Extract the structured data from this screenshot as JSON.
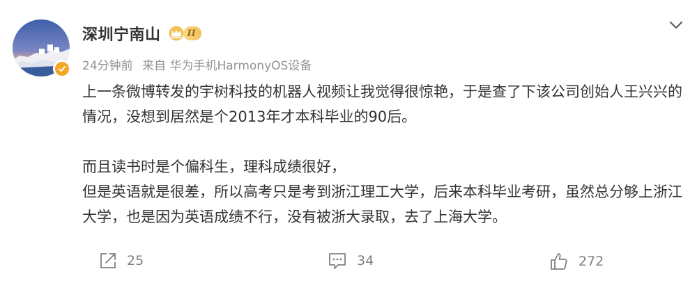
{
  "post": {
    "author": {
      "name": "深圳宁南山",
      "vip_rank": "II",
      "avatar_icon": "avatar-coastal-town",
      "verified_color": "#f5a623"
    },
    "meta": {
      "time": "24分钟前",
      "source": "来自 华为手机HarmonyOS设备"
    },
    "content": {
      "paragraph_1": "上一条微博转发的宇树科技的机器人视频让我觉得很惊艳，于是查了下该公司创始人王兴兴的情况，没想到居然是个2013年才本科毕业的90后。",
      "paragraph_2": "而且读书时是个偏科生，理科成绩很好，",
      "paragraph_3": "但是英语就是很差，所以高考只是考到浙江理工大学，后来本科毕业考研，虽然总分够上浙江大学，也是因为英语成绩不行，没有被浙大录取，去了上海大学。"
    },
    "actions": {
      "repost_count": "25",
      "comment_count": "34",
      "like_count": "272"
    }
  }
}
